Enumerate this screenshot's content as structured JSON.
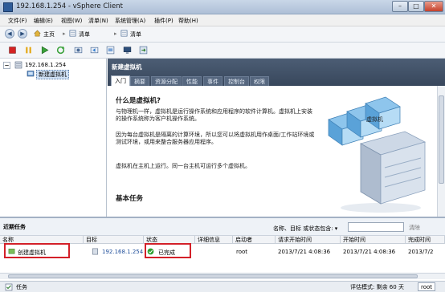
{
  "window": {
    "title": "192.168.1.254 - vSphere Client",
    "minimize": "–",
    "maximize": "□",
    "close": "✕"
  },
  "menu": [
    "文件(F)",
    "编辑(E)",
    "视图(W)",
    "清单(N)",
    "系统管理(A)",
    "插件(P)",
    "帮助(H)"
  ],
  "nav": {
    "back": "◀",
    "forward": "▶",
    "home_label": "主页",
    "sep": "▸",
    "crumb1": "清单",
    "crumb2": "清单"
  },
  "tree": {
    "root": "192.168.1.254",
    "child": "新建虚拟机"
  },
  "panel": {
    "title": "新建虚拟机",
    "tabs": [
      "入门",
      "摘要",
      "资源分配",
      "性能",
      "事件",
      "控制台",
      "权限"
    ],
    "heading": "什么是虚拟机?",
    "para1": "与物理机一样，虚拟机是运行操作系统和应用程序的软件计算机。虚拟机上安装的操作系统称为客户机操作系统。",
    "para2": "因为每台虚拟机是隔离的计算环境，所以您可以将虚拟机用作桌面/工作站环境或测试环境，或用来整合服务器应用程序。",
    "para3": "虚拟机在主机上运行。同一台主机可运行多个虚拟机。",
    "illustration_label": "虚拟机",
    "section2": "基本任务"
  },
  "tasks": {
    "title": "近期任务",
    "filter_label": "名称、目标 或状态包含: ▾",
    "filter_placeholder": "",
    "clear": "清除",
    "columns": [
      "名称",
      "目标",
      "状态",
      "详细信息",
      "启动者",
      "请求开始时间",
      "开始时间",
      "完成时间"
    ],
    "row": {
      "name": "创建虚拟机",
      "target": "192.168.1.254",
      "status": "已完成",
      "details": "",
      "initiator": "root",
      "requested": "2013/7/21 4:08:36",
      "started": "2013/7/21 4:08:36",
      "completed": "2013/7/2"
    }
  },
  "status": {
    "tasks_label": "任务",
    "eval_label": "评估模式: 剩余 60 天",
    "user": "root"
  }
}
